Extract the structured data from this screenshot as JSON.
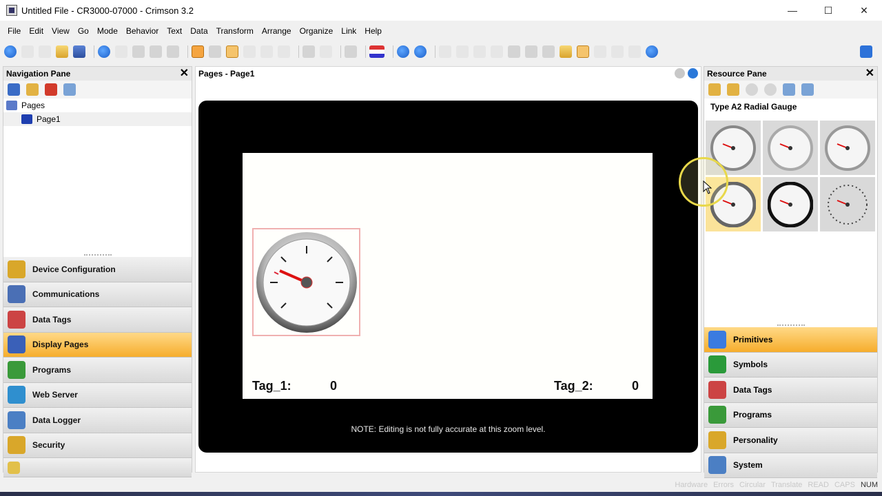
{
  "window": {
    "title": "Untitled File - CR3000-07000 - Crimson 3.2",
    "minimize": "—",
    "maximize": "☐",
    "close": "✕"
  },
  "menu": [
    "File",
    "Edit",
    "View",
    "Go",
    "Mode",
    "Behavior",
    "Text",
    "Data",
    "Transform",
    "Arrange",
    "Organize",
    "Link",
    "Help"
  ],
  "nav_pane": {
    "title": "Navigation Pane",
    "close": "✕",
    "tree": [
      {
        "label": "Pages"
      },
      {
        "label": "Page1"
      }
    ],
    "categories": [
      {
        "label": "Device Configuration",
        "icon": "gear-icon",
        "color": "#d9a72a"
      },
      {
        "label": "Communications",
        "icon": "network-icon",
        "color": "#4a6fb5"
      },
      {
        "label": "Data Tags",
        "icon": "tags-icon",
        "color": "#c44"
      },
      {
        "label": "Display Pages",
        "icon": "display-pages-icon",
        "color": "#3a60b8"
      },
      {
        "label": "Programs",
        "icon": "programs-icon",
        "color": "#3a9a3a"
      },
      {
        "label": "Web Server",
        "icon": "globe-icon",
        "color": "#2f8fcf"
      },
      {
        "label": "Data Logger",
        "icon": "chart-icon",
        "color": "#4b7fc4"
      },
      {
        "label": "Security",
        "icon": "key-icon",
        "color": "#d9a72a"
      }
    ]
  },
  "editor": {
    "title": "Pages - Page1",
    "tag1_label": "Tag_1:",
    "tag1_value": "0",
    "tag2_label": "Tag_2:",
    "tag2_value": "0",
    "zoom_note": "NOTE: Editing is not fully accurate at this zoom level."
  },
  "resource_pane": {
    "title": "Resource Pane",
    "close": "✕",
    "section_title": "Type A2 Radial Gauge",
    "categories": [
      {
        "label": "Primitives",
        "icon": "primitives-icon",
        "color": "#3a7be0"
      },
      {
        "label": "Symbols",
        "icon": "book-icon",
        "color": "#2a9a3a"
      },
      {
        "label": "Data Tags",
        "icon": "tags-icon",
        "color": "#c44"
      },
      {
        "label": "Programs",
        "icon": "programs-icon",
        "color": "#3a9a3a"
      },
      {
        "label": "Personality",
        "icon": "gear-icon",
        "color": "#d9a72a"
      },
      {
        "label": "System",
        "icon": "system-icon",
        "color": "#4b7fc4"
      }
    ]
  },
  "statusbar": [
    "Hardware",
    "Errors",
    "Circular",
    "Translate",
    "READ",
    "CAPS",
    "NUM"
  ]
}
